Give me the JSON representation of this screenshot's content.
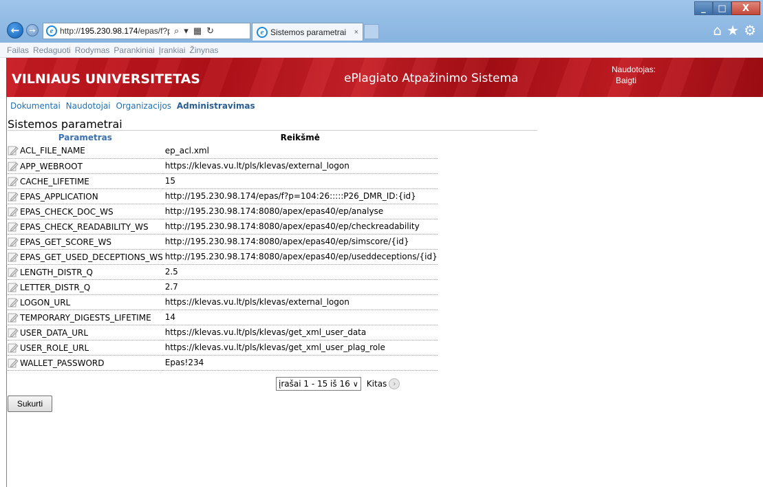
{
  "browser": {
    "url_prefix": "http://",
    "url_host": "195.230.98.174",
    "url_path": "/epas/f?p=",
    "tab_title": "Sistemos parametrai",
    "tab_close": "×",
    "window_minimize": "_",
    "window_maximize": "□",
    "window_close": "X",
    "menu": [
      "Failas",
      "Redaguoti",
      "Rodymas",
      "Parankiniai",
      "Įrankiai",
      "Žinynas"
    ]
  },
  "banner": {
    "university": "VILNIAUS UNIVERSITETAS",
    "system_name": "ePlagiato Atpažinimo Sistema",
    "user_label": "Naudotojas:",
    "logout": "Baigti"
  },
  "nav": {
    "items": [
      "Dokumentai",
      "Naudotojai",
      "Organizacijos",
      "Administravimas"
    ],
    "active": "Administravimas"
  },
  "page": {
    "title": "Sistemos parametrai"
  },
  "table": {
    "headers": [
      "Parametras",
      "Reikšmė"
    ],
    "rows": [
      {
        "param": "ACL_FILE_NAME",
        "value": "ep_acl.xml"
      },
      {
        "param": "APP_WEBROOT",
        "value": "https://klevas.vu.lt/pls/klevas/external_logon"
      },
      {
        "param": "CACHE_LIFETIME",
        "value": "15"
      },
      {
        "param": "EPAS_APPLICATION",
        "value": "http://195.230.98.174/epas/f?p=104:26:::::P26_DMR_ID:{id}"
      },
      {
        "param": "EPAS_CHECK_DOC_WS",
        "value": "http://195.230.98.174:8080/apex/epas40/ep/analyse"
      },
      {
        "param": "EPAS_CHECK_READABILITY_WS",
        "value": "http://195.230.98.174:8080/apex/epas40/ep/checkreadability"
      },
      {
        "param": "EPAS_GET_SCORE_WS",
        "value": "http://195.230.98.174:8080/apex/epas40/ep/simscore/{id}"
      },
      {
        "param": "EPAS_GET_USED_DECEPTIONS_WS",
        "value": "http://195.230.98.174:8080/apex/epas40/ep/useddeceptions/{id}"
      },
      {
        "param": "LENGTH_DISTR_Q",
        "value": "2.5"
      },
      {
        "param": "LETTER_DISTR_Q",
        "value": "2.7"
      },
      {
        "param": "LOGON_URL",
        "value": "https://klevas.vu.lt/pls/klevas/external_logon"
      },
      {
        "param": "TEMPORARY_DIGESTS_LIFETIME",
        "value": "14"
      },
      {
        "param": "USER_DATA_URL",
        "value": "https://klevas.vu.lt/pls/klevas/get_xml_user_data"
      },
      {
        "param": "USER_ROLE_URL",
        "value": "https://klevas.vu.lt/pls/klevas/get_xml_user_plag_role"
      },
      {
        "param": "WALLET_PASSWORD",
        "value": "Epas!234"
      }
    ]
  },
  "pagination": {
    "range_label": "įrašai 1 - 15 iš 16",
    "next_label": "Kitas"
  },
  "actions": {
    "create_label": "Sukurti"
  },
  "colors": {
    "banner_red": "#b51118",
    "link_blue": "#1f6fb5",
    "header_blue": "#3b6fae"
  }
}
